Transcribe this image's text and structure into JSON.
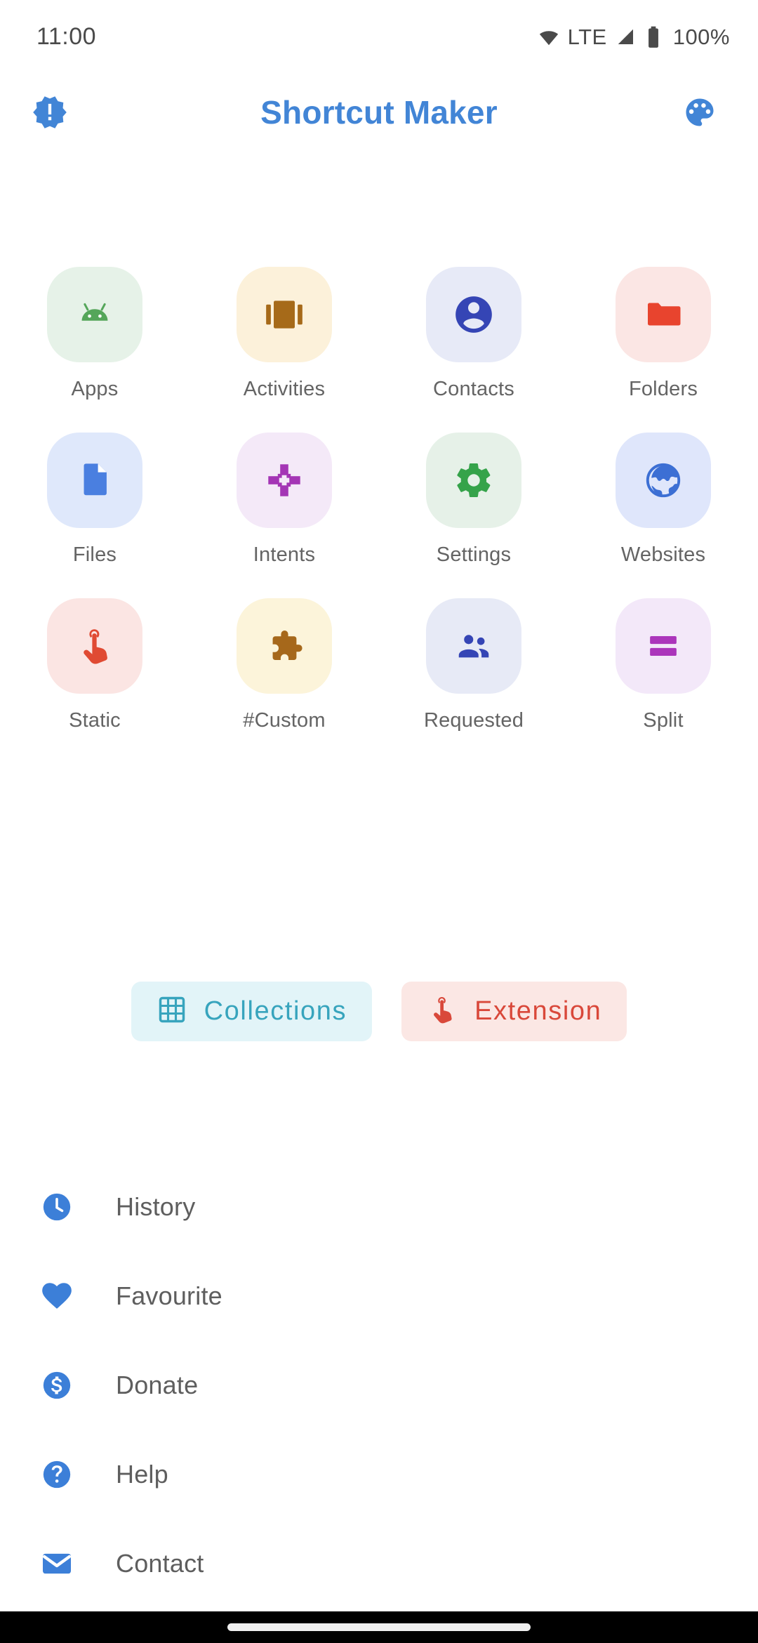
{
  "status_bar": {
    "time": "11:00",
    "network_type": "LTE",
    "battery_percent": "100%",
    "icons": [
      "wifi-icon",
      "signal-icon",
      "battery-icon"
    ]
  },
  "app_bar": {
    "title": "Shortcut Maker",
    "left_icon": "new-releases-badge-icon",
    "right_icon": "palette-icon",
    "title_color": "#4285d6"
  },
  "grid": {
    "items": [
      {
        "label": "Apps",
        "icon": "android-icon",
        "icon_color": "#55a65a",
        "tile_color": "#e6f2e8"
      },
      {
        "label": "Activities",
        "icon": "view-carousel-icon",
        "icon_color": "#a66a19",
        "tile_color": "#fcf1da"
      },
      {
        "label": "Contacts",
        "icon": "account-circle-icon",
        "icon_color": "#3545b5",
        "tile_color": "#e7eaf7"
      },
      {
        "label": "Folders",
        "icon": "folder-icon",
        "icon_color": "#e8442e",
        "tile_color": "#fbe6e4"
      },
      {
        "label": "Files",
        "icon": "document-icon",
        "icon_color": "#4a7fe0",
        "tile_color": "#dfe8fb"
      },
      {
        "label": "Intents",
        "icon": "intent-arrows-icon",
        "icon_color": "#a435b5",
        "tile_color": "#f4e9f8"
      },
      {
        "label": "Settings",
        "icon": "gear-icon",
        "icon_color": "#35a34a",
        "tile_color": "#e6f1e8"
      },
      {
        "label": "Websites",
        "icon": "globe-icon",
        "icon_color": "#3c6fd4",
        "tile_color": "#dfe6fb"
      },
      {
        "label": "Static",
        "icon": "touch-app-icon",
        "icon_color": "#e04a33",
        "tile_color": "#fbe5e3"
      },
      {
        "label": "#Custom",
        "icon": "puzzle-piece-icon",
        "icon_color": "#a6681b",
        "tile_color": "#fcf4da"
      },
      {
        "label": "Requested",
        "icon": "people-icon",
        "icon_color": "#3545b5",
        "tile_color": "#e7eaf6"
      },
      {
        "label": "Split",
        "icon": "split-bars-icon",
        "icon_color": "#ab35bb",
        "tile_color": "#f3e8f9"
      }
    ]
  },
  "chips": [
    {
      "label": "Collections",
      "icon": "grid-on-icon",
      "text_color": "#37a4bd",
      "background": "#e2f4f8"
    },
    {
      "label": "Extension",
      "icon": "touch-app-icon",
      "text_color": "#d9483a",
      "background": "#fbe7e4"
    }
  ],
  "menu": {
    "items": [
      {
        "label": "History",
        "icon": "clock-icon",
        "icon_color": "#3c7fd8"
      },
      {
        "label": "Favourite",
        "icon": "heart-icon",
        "icon_color": "#3c7fd8"
      },
      {
        "label": "Donate",
        "icon": "dollar-circle-icon",
        "icon_color": "#3c7fd8"
      },
      {
        "label": "Help",
        "icon": "help-circle-icon",
        "icon_color": "#3c7fd8"
      },
      {
        "label": "Contact",
        "icon": "envelope-icon",
        "icon_color": "#3c7fd8"
      }
    ]
  },
  "nav_bar": {
    "gesture_pill": "home-gesture-pill"
  }
}
